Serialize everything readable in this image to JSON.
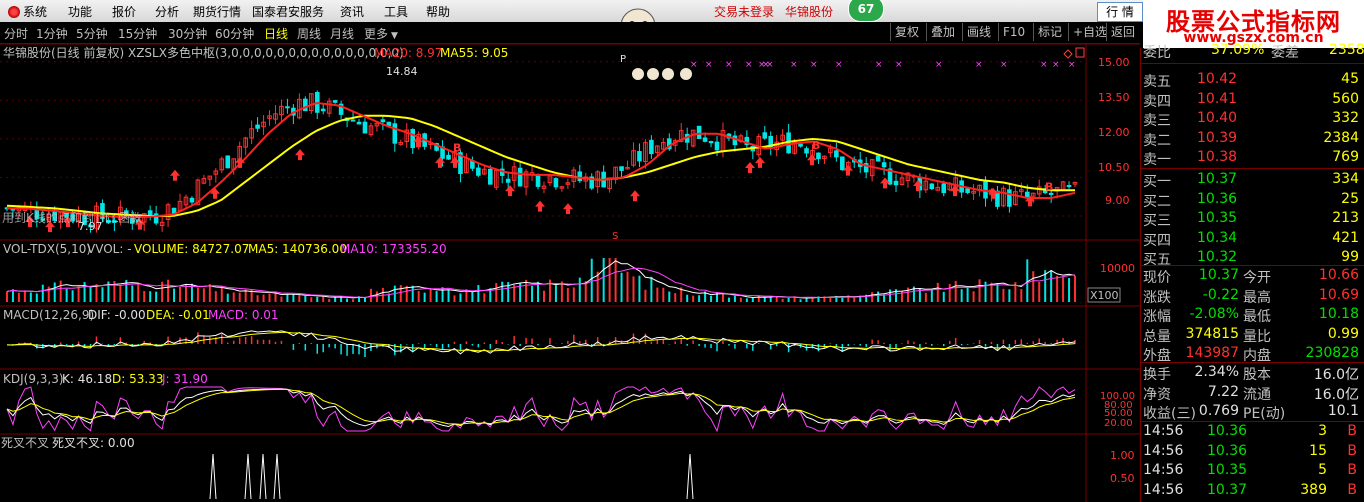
{
  "menubar": {
    "items": [
      "系统",
      "功能",
      "报价",
      "分析",
      "期货行情",
      "国泰君安服务",
      "资讯",
      "工具",
      "帮助"
    ],
    "trade_status": "交易未登录",
    "stock_name": "华锦股份",
    "badge": "67",
    "hangqing": "行 情"
  },
  "watermark": {
    "title": "股票公式指标网",
    "url": "www.gszx.com.cn"
  },
  "tabs": {
    "periods": [
      "分时",
      "1分钟",
      "5分钟",
      "15分钟",
      "30分钟",
      "60分钟",
      "日线",
      "周线",
      "月线",
      "更多"
    ],
    "active": "日线",
    "buttons": [
      "复权",
      "叠加",
      "画线",
      "F10",
      "标记",
      "+自选",
      "返回"
    ]
  },
  "main_panel": {
    "title": "华锦股份(日线 前复权) XZSLX多色中枢(3,0,0,0,0,0,0,0,0,0,0,0,0,0,0,0)",
    "ma20_label": "MA20: 8.97",
    "ma55_label": "MA55: 9.05",
    "high_label": "14.84",
    "low_label": "7.97",
    "overlay_text": "用到K线的点和到TILL函数",
    "y_ticks": [
      "15.00",
      "13.50",
      "12.00",
      "10.50",
      "9.00"
    ],
    "marker_s": "S",
    "marker_b": "B",
    "marker_p": "P",
    "colors": {
      "up": "#ff3030",
      "down": "#00e5e5",
      "ma20": "#ff2020",
      "ma55": "#ffff00"
    }
  },
  "vol_panel": {
    "name": "VOL-TDX(5,10)",
    "vvol": "VVOL: -",
    "volume": "VOLUME: 84727.07",
    "ma5": "MA5: 140736.00",
    "ma10": "MA10: 173355.20",
    "y_tick": "10000",
    "unit": "X100"
  },
  "macd_panel": {
    "name": "MACD(12,26,9)",
    "dif": "DIF: -0.00",
    "dea": "DEA: -0.01",
    "macd": "MACD: 0.01"
  },
  "kdj_panel": {
    "name": "KDJ(9,3,3)",
    "k": "K: 46.18",
    "d": "D: 53.33",
    "j": "J: 31.90",
    "y_ticks": [
      "100.00",
      "80.00",
      "50.00",
      "20.00"
    ]
  },
  "cross_panel": {
    "name": "死叉不叉",
    "value": "死叉不叉: 0.00",
    "y_ticks": [
      "1.00",
      "0.50"
    ]
  },
  "quote": {
    "top_partial": {
      "label": "委比",
      "value": "37.09%",
      "label2": "委差",
      "value2": "2358"
    },
    "asks": [
      {
        "label": "卖五",
        "price": "10.42",
        "vol": "45"
      },
      {
        "label": "卖四",
        "price": "10.41",
        "vol": "560"
      },
      {
        "label": "卖三",
        "price": "10.40",
        "vol": "332"
      },
      {
        "label": "卖二",
        "price": "10.39",
        "vol": "2384"
      },
      {
        "label": "卖一",
        "price": "10.38",
        "vol": "769"
      }
    ],
    "bids": [
      {
        "label": "买一",
        "price": "10.37",
        "vol": "334"
      },
      {
        "label": "买二",
        "price": "10.36",
        "vol": "25"
      },
      {
        "label": "买三",
        "price": "10.35",
        "vol": "213"
      },
      {
        "label": "买四",
        "price": "10.34",
        "vol": "421"
      },
      {
        "label": "买五",
        "price": "10.32",
        "vol": "99"
      }
    ],
    "stats": [
      {
        "l1": "现价",
        "v1": "10.37",
        "c1": "grn",
        "l2": "今开",
        "v2": "10.66",
        "c2": "red"
      },
      {
        "l1": "涨跌",
        "v1": "-0.22",
        "c1": "grn",
        "l2": "最高",
        "v2": "10.69",
        "c2": "red"
      },
      {
        "l1": "涨幅",
        "v1": "-2.08%",
        "c1": "grn",
        "l2": "最低",
        "v2": "10.18",
        "c2": "grn"
      },
      {
        "l1": "总量",
        "v1": "374815",
        "c1": "yel",
        "l2": "量比",
        "v2": "0.99",
        "c2": "yel"
      },
      {
        "l1": "外盘",
        "v1": "143987",
        "c1": "red",
        "l2": "内盘",
        "v2": "230828",
        "c2": "grn"
      }
    ],
    "stats2": [
      {
        "l1": "换手",
        "v1": "2.34%",
        "l2": "股本",
        "v2": "16.0亿"
      },
      {
        "l1": "净资",
        "v1": "7.22",
        "l2": "流通",
        "v2": "16.0亿"
      },
      {
        "l1": "收益(三)",
        "v1": "0.769",
        "l2": "PE(动)",
        "v2": "10.1"
      }
    ],
    "ticks": [
      {
        "time": "14:56",
        "price": "10.36",
        "vol": "3",
        "side": "B"
      },
      {
        "time": "14:56",
        "price": "10.36",
        "vol": "15",
        "side": "B"
      },
      {
        "time": "14:56",
        "price": "10.35",
        "vol": "5",
        "side": "B"
      },
      {
        "time": "14:56",
        "price": "10.37",
        "vol": "389",
        "side": "B"
      }
    ]
  },
  "chart_data": {
    "type": "candlestick",
    "ylim": [
      8.3,
      15.3
    ],
    "ma20": [
      9.3,
      9.28,
      9.2,
      9.1,
      9.0,
      8.95,
      8.97,
      9.05,
      9.5,
      10.3,
      11.2,
      12.2,
      13.0,
      13.4,
      13.3,
      12.9,
      12.5,
      12.2,
      11.8,
      11.4,
      11.0,
      10.7,
      10.6,
      10.6,
      10.5,
      10.4,
      10.5,
      11.0,
      11.8,
      12.2,
      12.2,
      11.9,
      11.6,
      11.8,
      11.9,
      11.6,
      11.0,
      10.8,
      10.6,
      10.4,
      10.2,
      10.0,
      9.9,
      9.7,
      9.7,
      9.9
    ],
    "ma55": [
      9.4,
      9.35,
      9.3,
      9.2,
      9.1,
      9.05,
      9.0,
      9.0,
      9.2,
      9.6,
      10.3,
      11.0,
      11.7,
      12.3,
      12.7,
      12.9,
      12.9,
      12.8,
      12.5,
      12.1,
      11.7,
      11.3,
      11.0,
      10.7,
      10.5,
      10.4,
      10.5,
      10.7,
      11.0,
      11.3,
      11.5,
      11.6,
      11.7,
      11.9,
      12.0,
      11.9,
      11.6,
      11.3,
      11.0,
      10.8,
      10.6,
      10.4,
      10.3,
      10.1,
      10.0,
      10.0
    ]
  }
}
